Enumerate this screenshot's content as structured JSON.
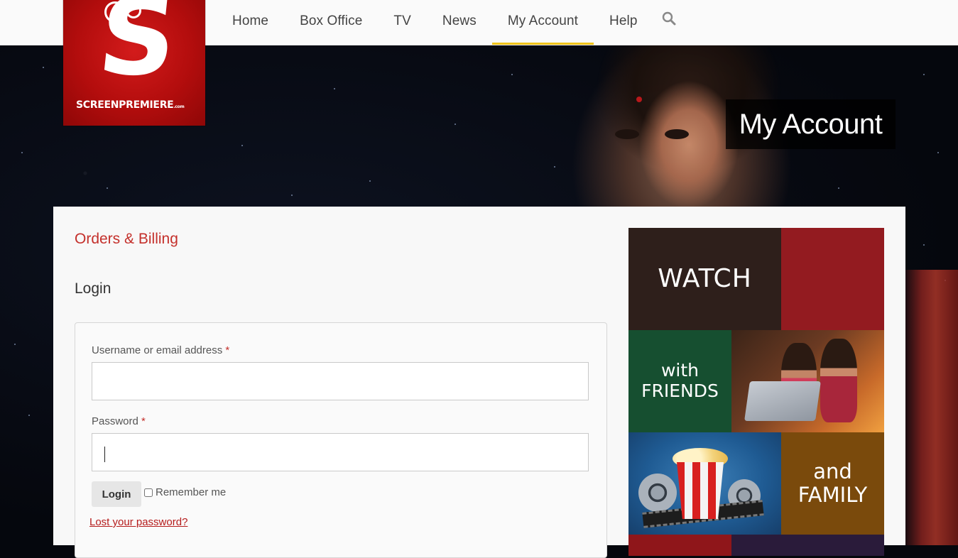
{
  "logo": {
    "wordmark": "SCREENPREMIERE",
    "suffix": ".com",
    "letter": "S"
  },
  "nav": {
    "items": [
      {
        "label": "Home"
      },
      {
        "label": "Box Office"
      },
      {
        "label": "TV"
      },
      {
        "label": "News"
      },
      {
        "label": "My Account",
        "active": true
      },
      {
        "label": "Help"
      }
    ],
    "active_underline_color": "#f0c419"
  },
  "hero": {
    "title": "My Account"
  },
  "account": {
    "orders_link": "Orders & Billing",
    "login_title": "Login",
    "username_label": "Username or email address",
    "username_value": "",
    "password_label": "Password",
    "password_value": "",
    "required_marker": "*",
    "login_button": "Login",
    "remember_label": "Remember me",
    "remember_checked": false,
    "lost_password": "Lost your password?"
  },
  "promo": {
    "watch": "WATCH",
    "friends_line1": "with",
    "friends_line2": "FRIENDS",
    "family_line1": "and",
    "family_line2": "FAMILY"
  },
  "colors": {
    "brand_red": "#b30d0d",
    "link_red": "#c4302b"
  }
}
